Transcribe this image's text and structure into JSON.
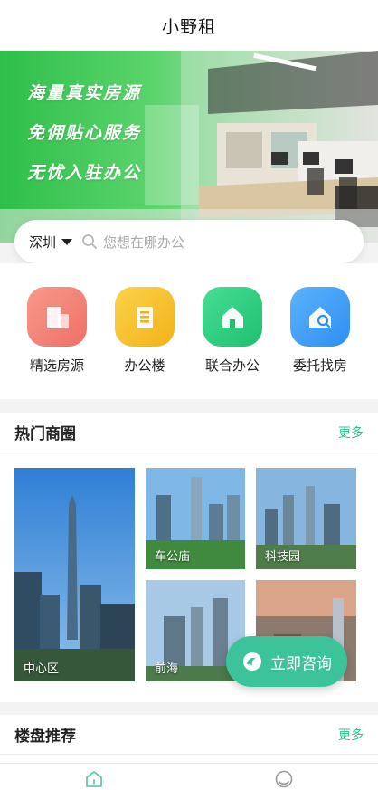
{
  "nav": {
    "title": "小野租"
  },
  "banner": {
    "lines": [
      "海量真实房源",
      "免佣贴心服务",
      "无忧入驻办公"
    ]
  },
  "search": {
    "city": "深圳",
    "placeholder": "您想在哪办公"
  },
  "quick": [
    {
      "label": "精选房源",
      "icon": "building-icon",
      "color": "#f47f72"
    },
    {
      "label": "办公楼",
      "icon": "office-icon",
      "color": "#f7c42b"
    },
    {
      "label": "联合办公",
      "icon": "house-icon",
      "color": "#2fcf82"
    },
    {
      "label": "委托找房",
      "icon": "house-search-icon",
      "color": "#3d9df5"
    }
  ],
  "hot": {
    "title": "热门商圈",
    "more": "更多",
    "areas": [
      "中心区",
      "车公庙",
      "科技园",
      "前海",
      ""
    ]
  },
  "fab": {
    "label": "立即咨询"
  },
  "recommend": {
    "title": "楼盘推荐",
    "more": "更多"
  },
  "colors": {
    "accent": "#3cc39a",
    "tab_active": "#5fd0a6"
  }
}
